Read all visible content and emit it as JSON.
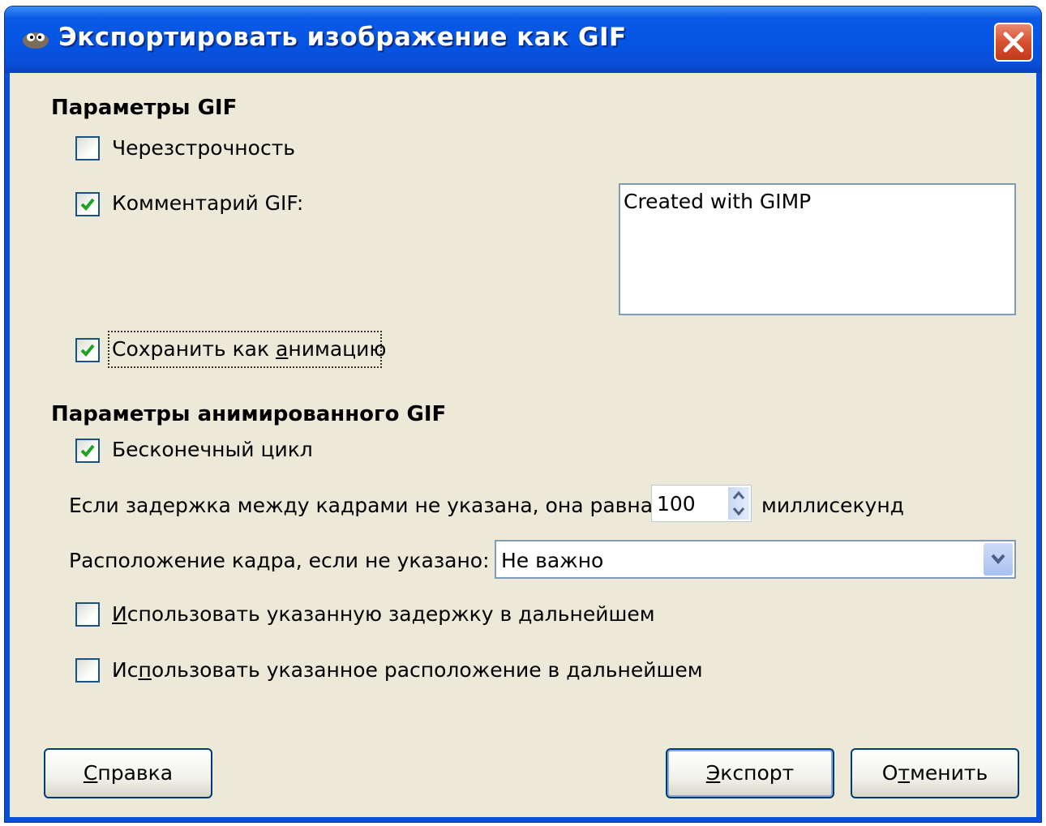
{
  "window": {
    "title": "Экспортировать изображение как GIF"
  },
  "gif_params": {
    "heading": "Параметры GIF",
    "interlace": {
      "label": "Черезстрочность",
      "checked": false
    },
    "comment": {
      "label": "Комментарий GIF:",
      "checked": true,
      "value": "Created with GIMP"
    },
    "animation": {
      "label_pre": "Сохранить как ",
      "label_mnemonic": "а",
      "label_post": "нимацию",
      "checked": true
    }
  },
  "anim_params": {
    "heading": "Параметры анимированного GIF",
    "loop": {
      "label": "Бесконечный цикл",
      "checked": true
    },
    "delay": {
      "label": "Если задержка между кадрами не указана, она равна:",
      "value": "100",
      "unit": "миллисекунд"
    },
    "disposal": {
      "label": "Расположение кадра, если не указано:",
      "value": "Не важно"
    },
    "use_delay": {
      "label_mnemonic": "И",
      "label_post": "спользовать указанную задержку в дальнейшем",
      "checked": false
    },
    "use_disposal": {
      "label_pre": "Ис",
      "label_mnemonic": "п",
      "label_post": "ользовать указанное расположение в дальнейшем",
      "checked": false
    }
  },
  "buttons": {
    "help": {
      "mnemonic": "С",
      "rest": "правка"
    },
    "export": {
      "mnemonic": "Э",
      "rest": "кспорт"
    },
    "cancel": {
      "pre": "О",
      "mnemonic": "т",
      "rest": "менить"
    }
  },
  "colors": {
    "titlebar": "#0a4fd8",
    "client": "#ece9d8",
    "check": "#21a121",
    "close": "#d7502f"
  }
}
